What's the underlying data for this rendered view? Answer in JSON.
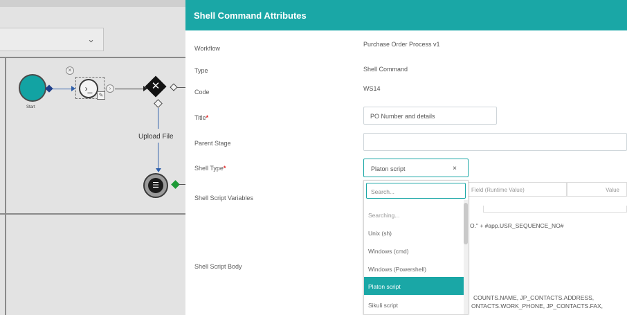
{
  "canvas": {
    "start_label": "Start",
    "upload_label": "Upload File",
    "dropdown_chevron": "chevron-down-icon"
  },
  "dialog": {
    "title": "Shell Command Attributes",
    "fields": {
      "workflow_label": "Workflow",
      "workflow_value": "Purchase Order Process v1",
      "type_label": "Type",
      "type_value": "Shell Command",
      "code_label": "Code",
      "code_value": "WS14",
      "title_label": "Title",
      "title_value": "PO Number and details",
      "parent_stage_label": "Parent Stage",
      "parent_stage_value": "",
      "shell_type_label": "Shell Type",
      "shell_type_value": "Platon script",
      "script_vars_label": "Shell Script Variables",
      "script_body_label": "Shell Script Body"
    },
    "vars_table": {
      "col_field": "Field (Runtime Value)",
      "col_value": "Value"
    },
    "script_body": {
      "line1": "O.\" + #app.USR_SEQUENCE_NO#",
      "line2": "COUNTS.NAME, JP_CONTACTS.ADDRESS,",
      "line3": "ONTACTS.WORK_PHONE, JP_CONTACTS.FAX,"
    },
    "dropdown": {
      "search_placeholder": "Search...",
      "status": "Searching...",
      "options": [
        "Unix (sh)",
        "Windows (cmd)",
        "Windows (Powershell)",
        "Platon script",
        "Sikuli script"
      ],
      "selected": "Platon script"
    }
  },
  "colors": {
    "accent": "#1aa7a6",
    "required": "#e02020"
  }
}
